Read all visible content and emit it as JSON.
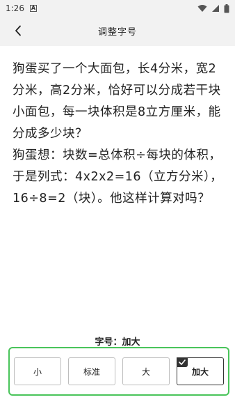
{
  "status_bar": {
    "time": "1:26",
    "notification_letter": "A"
  },
  "header": {
    "title": "调整字号"
  },
  "article": {
    "paragraphs": [
      "狗蛋买了一个大面包，长4分米，宽2分米，高2分米，恰好可以分成若干块小面包，每一块体积是8立方厘米，能分成多少块？",
      "狗蛋想：块数=总体积÷每块的体积，于是列式：4x2x2=16（立方分米），16÷8=2（块）。他这样计算对吗？"
    ]
  },
  "font_size": {
    "label": "字号：加大",
    "options": [
      {
        "label": "小",
        "selected": false
      },
      {
        "label": "标准",
        "selected": false
      },
      {
        "label": "大",
        "selected": false
      },
      {
        "label": "加大",
        "selected": true
      }
    ]
  },
  "colors": {
    "panel_border": "#49c45a",
    "selected_badge": "#333333"
  }
}
